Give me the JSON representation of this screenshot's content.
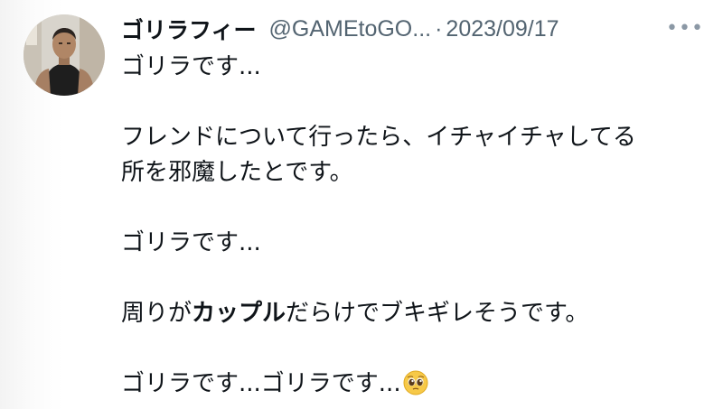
{
  "tweet": {
    "author": {
      "display_name": "ゴリラフィー",
      "handle": "@GAMEtoGO...",
      "separator": "·"
    },
    "date": "2023/09/17",
    "more_label": "•••",
    "lines": {
      "l1": "ゴリラです...",
      "l2": "フレンドについて行ったら、イチャイチャしてる",
      "l3": "所を邪魔したとです。",
      "l4": "ゴリラです...",
      "l5_pre": "周りが",
      "l5_bold": "カップル",
      "l5_post": "だらけでブキギレそうです。",
      "l6": "ゴリラです...ゴリラです..."
    },
    "emoji": "pleading-face"
  },
  "colors": {
    "text": "#0f1419",
    "secondary": "#536471",
    "background": "#ffffff"
  }
}
